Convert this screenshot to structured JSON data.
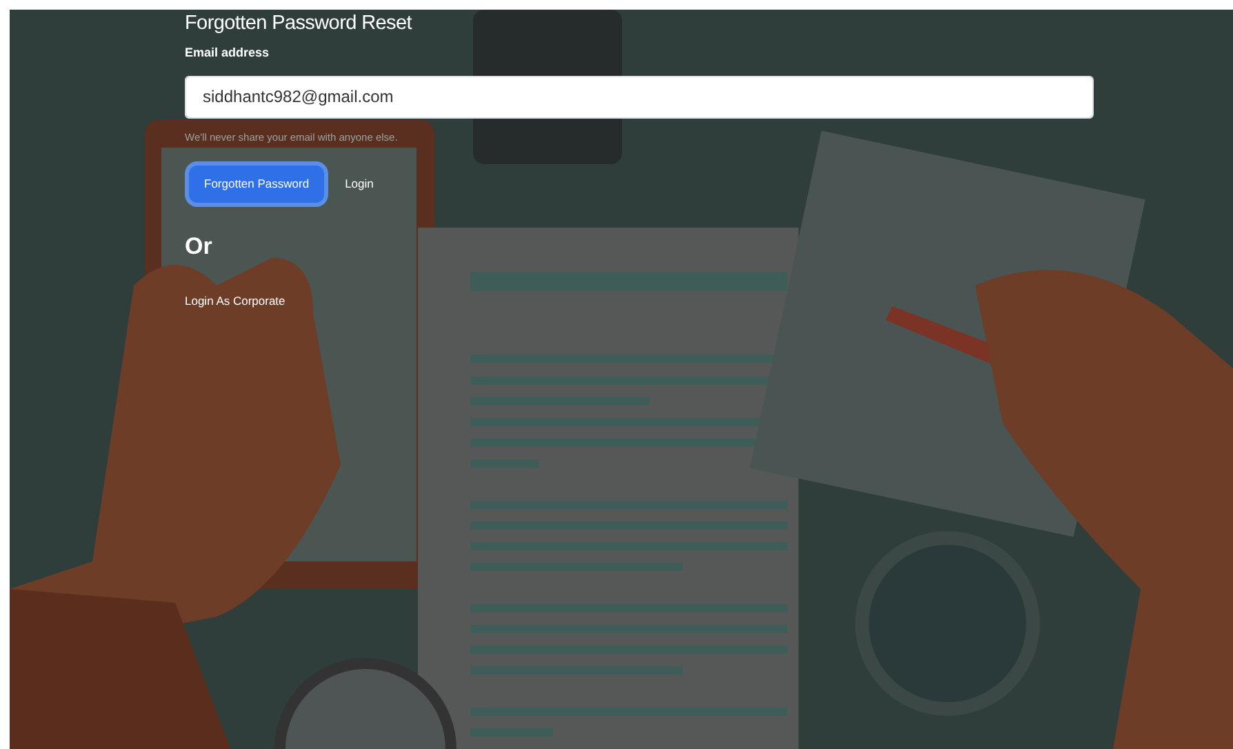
{
  "form": {
    "title": "Forgotten Password Reset",
    "email_label": "Email address",
    "email_value": "siddhantc982@gmail.com",
    "help_text": "We'll never share your email with anyone else.",
    "buttons": [
      {
        "label": "Forgotten Password",
        "kind": "primary"
      },
      {
        "label": "Login",
        "kind": "link"
      }
    ],
    "separator": "Or",
    "corporate_link": "Login As Corporate"
  }
}
